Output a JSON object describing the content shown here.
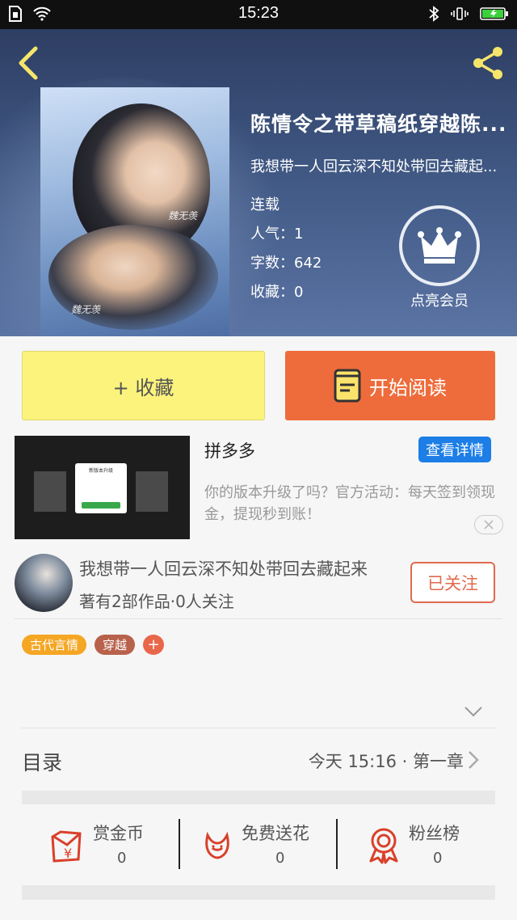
{
  "status_bar": {
    "time": "15:23"
  },
  "book": {
    "title": "陈情令之带草稿纸穿越陈...",
    "author_line": "我想带一人回云深不知处带回去藏起...",
    "status": "连载",
    "popularity": "人气：1",
    "word_count": "字数：642",
    "favorites": "收藏：0",
    "cover_signature": "魏无羡"
  },
  "vip": {
    "label": "点亮会员"
  },
  "actions": {
    "collect_label": "+ 收藏",
    "read_label": "开始阅读"
  },
  "ad": {
    "title": "拼多多",
    "detail_label": "查看详情",
    "description": "你的版本升级了吗？官方活动：每天签到领现金，提现秒到账！",
    "popup_title": "新版本升级",
    "popup_button": "去升级"
  },
  "author": {
    "name": "我想带一人回云深不知处带回去藏起来",
    "stats": "著有2部作品·0人关注",
    "follow_label": "已关注"
  },
  "tags": [
    {
      "label": "古代言情",
      "color": "#f5a623"
    },
    {
      "label": "穿越",
      "color": "#b8614b"
    }
  ],
  "tag_add": "+",
  "catalog": {
    "title": "目录",
    "latest": "今天 15:16 · 第一章"
  },
  "stats": [
    {
      "name": "赏金币",
      "count": "0"
    },
    {
      "name": "免费送花",
      "count": "0"
    },
    {
      "name": "粉丝榜",
      "count": "0"
    }
  ],
  "colors": {
    "accent_orange": "#ee6c3b",
    "collect_yellow": "#fbf37c",
    "icon_red": "#d9402b",
    "blue": "#1c7ee6"
  }
}
